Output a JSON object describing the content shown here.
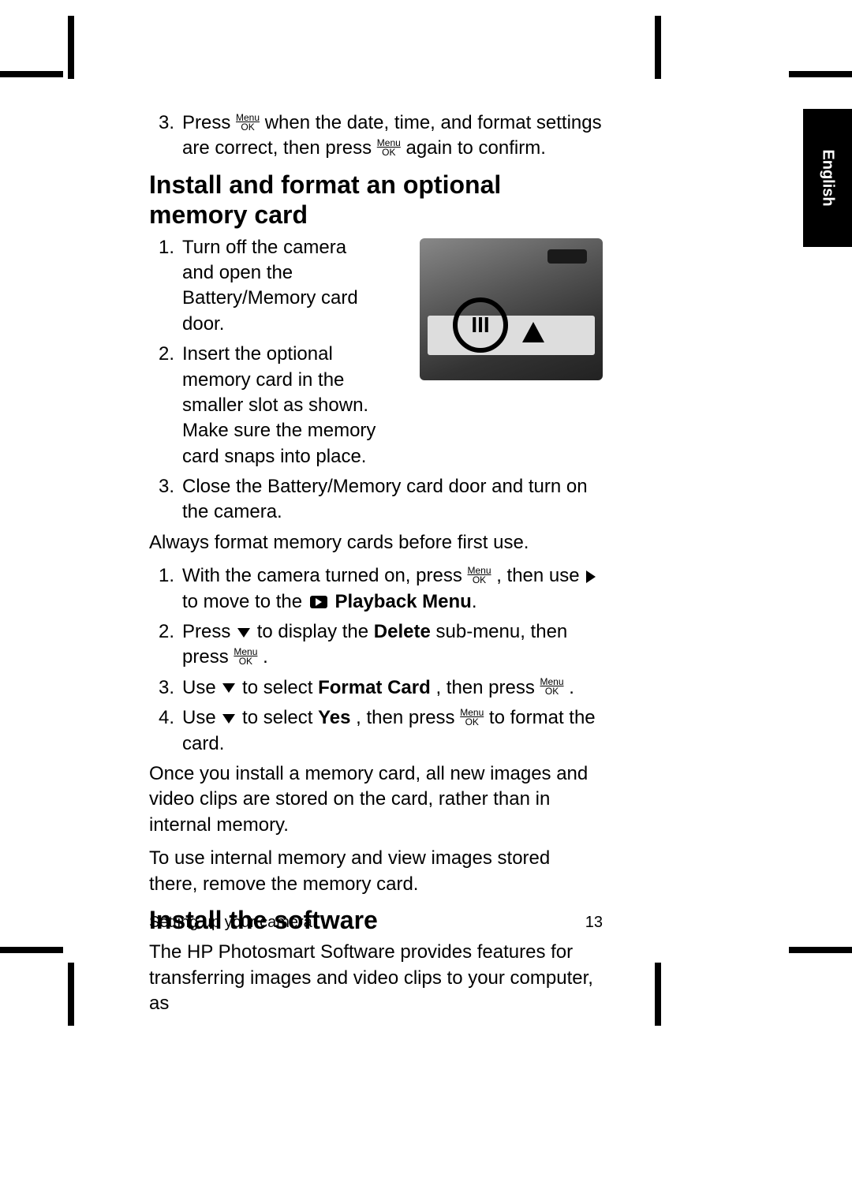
{
  "side_tab": "English",
  "intro_list": [
    {
      "num": "3.",
      "pre": "Press ",
      "mid": " when the date, time, and format settings are correct, then press ",
      "post": " again to confirm."
    }
  ],
  "heading1": "Install and format an optional memory card",
  "mc_list": [
    {
      "num": "1.",
      "text": "Turn off the camera and open the Battery/Memory card door."
    },
    {
      "num": "2.",
      "text": "Insert the optional memory card in the smaller slot as shown. Make sure the memory card snaps into place."
    },
    {
      "num": "3.",
      "text": "Close the Battery/Memory card door and turn on the camera."
    }
  ],
  "para_always": "Always format memory cards before first use.",
  "fmt_list": {
    "i1": {
      "num": "1.",
      "a": "With the camera turned on, press ",
      "b": ", then use ",
      "c": " to move to the ",
      "d": "Playback Menu",
      "e": "."
    },
    "i2": {
      "num": "2.",
      "a": "Press ",
      "b": " to display the ",
      "c": "Delete",
      "d": " sub-menu, then press ",
      "e": "."
    },
    "i3": {
      "num": "3.",
      "a": "Use ",
      "b": " to select ",
      "c": "Format Card",
      "d": ", then press ",
      "e": "."
    },
    "i4": {
      "num": "4.",
      "a": "Use ",
      "b": " to select ",
      "c": "Yes",
      "d": ", then press ",
      "e": " to format the card."
    }
  },
  "para_once": "Once you install a memory card, all new images and video clips are stored on the card, rather than in internal memory.",
  "para_internal": "To use internal memory and view images stored there, remove the memory card.",
  "heading2": "Install the software",
  "para_sw": "The HP Photosmart Software provides features for transferring images and video clips to your computer, as",
  "footer_left": "Setting up your camera",
  "footer_right": "13",
  "menu_ok": {
    "top": "Menu",
    "bot": "OK"
  },
  "camera_label": "III"
}
